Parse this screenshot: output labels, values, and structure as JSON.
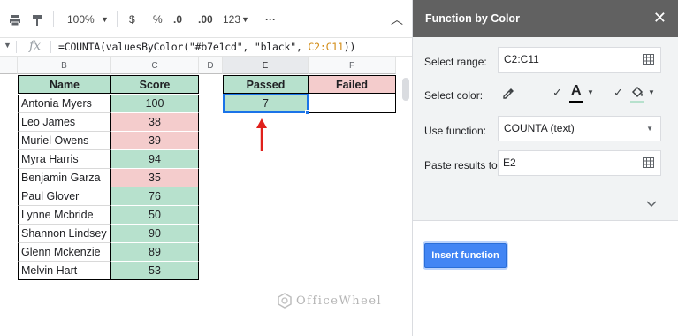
{
  "toolbar": {
    "zoom": "100%",
    "currency": "$",
    "percent": "%",
    "decrease_decimal": ".0",
    "increase_decimal": ".00",
    "number_format": "123",
    "more": "···"
  },
  "formula_bar": {
    "fx": "fx",
    "formula_prefix": "=COUNTA(valuesByColor(\"#b7e1cd\", \"black\", ",
    "formula_range": "C2:C11",
    "formula_suffix": "))"
  },
  "columns": [
    "B",
    "C",
    "D",
    "E",
    "F"
  ],
  "table": {
    "header_name": "Name",
    "header_score": "Score",
    "rows": [
      {
        "name": "Antonia Myers",
        "score": "100",
        "color": "green"
      },
      {
        "name": "Leo James",
        "score": "38",
        "color": "pink"
      },
      {
        "name": "Muriel Owens",
        "score": "39",
        "color": "pink"
      },
      {
        "name": "Myra Harris",
        "score": "94",
        "color": "green"
      },
      {
        "name": "Benjamin Garza",
        "score": "35",
        "color": "pink"
      },
      {
        "name": "Paul Glover",
        "score": "76",
        "color": "green"
      },
      {
        "name": "Lynne Mcbride",
        "score": "50",
        "color": "green"
      },
      {
        "name": "Shannon Lindsey",
        "score": "90",
        "color": "green"
      },
      {
        "name": "Glenn Mckenzie",
        "score": "89",
        "color": "green"
      },
      {
        "name": "Melvin Hart",
        "score": "53",
        "color": "green"
      }
    ]
  },
  "result": {
    "passed_label": "Passed",
    "failed_label": "Failed",
    "passed_value": "7"
  },
  "watermark": "OfficeWheel",
  "colors": {
    "green": "#b7e1cd",
    "pink": "#f4cccc",
    "panel_header": "#616161",
    "accent": "#4285f4",
    "arrow": "#e0201b"
  },
  "panel": {
    "title": "Function by Color",
    "select_range_label": "Select range:",
    "select_range_value": "C2:C11",
    "select_color_label": "Select color:",
    "text_color_letter": "A",
    "use_function_label": "Use function:",
    "use_function_value": "COUNTA (text)",
    "paste_results_label": "Paste results to:",
    "paste_results_value": "E2",
    "insert_button": "Insert function"
  }
}
